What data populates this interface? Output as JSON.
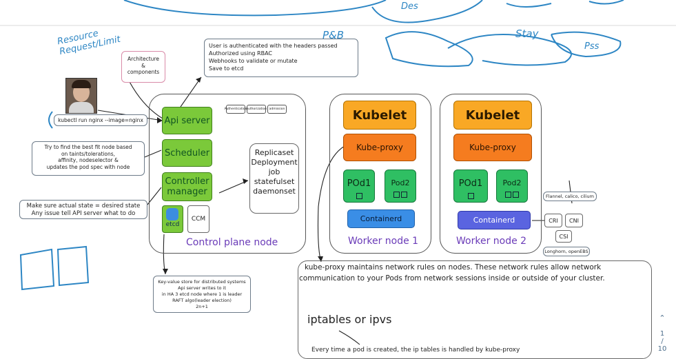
{
  "handwriting": {
    "resource_request_limit": [
      "Resource",
      "Request/Limit"
    ],
    "top_right_1": "P&B",
    "top_right_2": "Stay",
    "top_right_3": "Des",
    "top_right_4": "Pss"
  },
  "architecture_label": [
    "Architecture",
    "&",
    "components"
  ],
  "user_auth_note": [
    "User is authenticated with the headers passed",
    "Authorized using RBAC",
    "Webhooks to validate or mutate",
    "Save to etcd"
  ],
  "kubectl_cmd": "kubectl run nginx --image=nginx",
  "scheduler_note": [
    "Try to find the best fit node based",
    "on taints/tolerations,",
    "affinity, nodeselector &",
    "updates the pod spec with node"
  ],
  "controller_note": [
    "Make sure actual state = desired state",
    "Any issue tell API server what to do"
  ],
  "etcd_note": [
    "Key-value store for distributed systems",
    "Api server writes to it",
    "in HA 3 etcd node where 1 is leader",
    "RAFT algo(leader election)",
    "2n+1"
  ],
  "control_plane": {
    "api_server": "Api server",
    "scheduler": "Scheduler",
    "controller_manager": [
      "Controller",
      "manager"
    ],
    "etcd": "etcd",
    "ccm": "CCM",
    "admission_boxes": [
      "Authentication",
      "Authorization",
      "admission"
    ],
    "label": "Control plane node"
  },
  "controllers_list": [
    "Replicaset",
    "Deployment",
    "job",
    "statefulset",
    "daemonset"
  ],
  "worker1": {
    "kubelet": "Kubelet",
    "kube_proxy": "Kube-proxy",
    "pod1": "POd1",
    "pod2": "Pod2",
    "containerd": "Containerd",
    "label": "Worker node 1"
  },
  "worker2": {
    "kubelet": "Kubelet",
    "kube_proxy": "Kube-proxy",
    "pod1": "POd1",
    "pod2": "Pod2",
    "containerd": "Containerd",
    "label": "Worker node 2"
  },
  "interfaces": {
    "cri": "CRI",
    "cni": "CNI",
    "csi": "CSI",
    "cni_note": "Flannel, calico, cilium",
    "csi_note": "Longhorn, openEBS"
  },
  "kube_proxy_note": {
    "line1": "kube-proxy maintains network rules on nodes. These network rules allow network",
    "line2": "communication to your Pods from network sessions inside or outside of your cluster.",
    "iptables": "iptables or ipvs",
    "footer": "Every time a pod is created, the ip tables is handled by kube-proxy"
  },
  "pager": {
    "current": "1",
    "separator": "/",
    "total": "10"
  },
  "colors": {
    "green": "#7bc93a",
    "orange": "#f9a825",
    "orange_dark": "#f57c1f",
    "pod_green": "#2fbf63",
    "containerd_blue": "#3a8ee6",
    "purple_label": "#6a3bb8",
    "ink_blue": "#2d86c4"
  }
}
